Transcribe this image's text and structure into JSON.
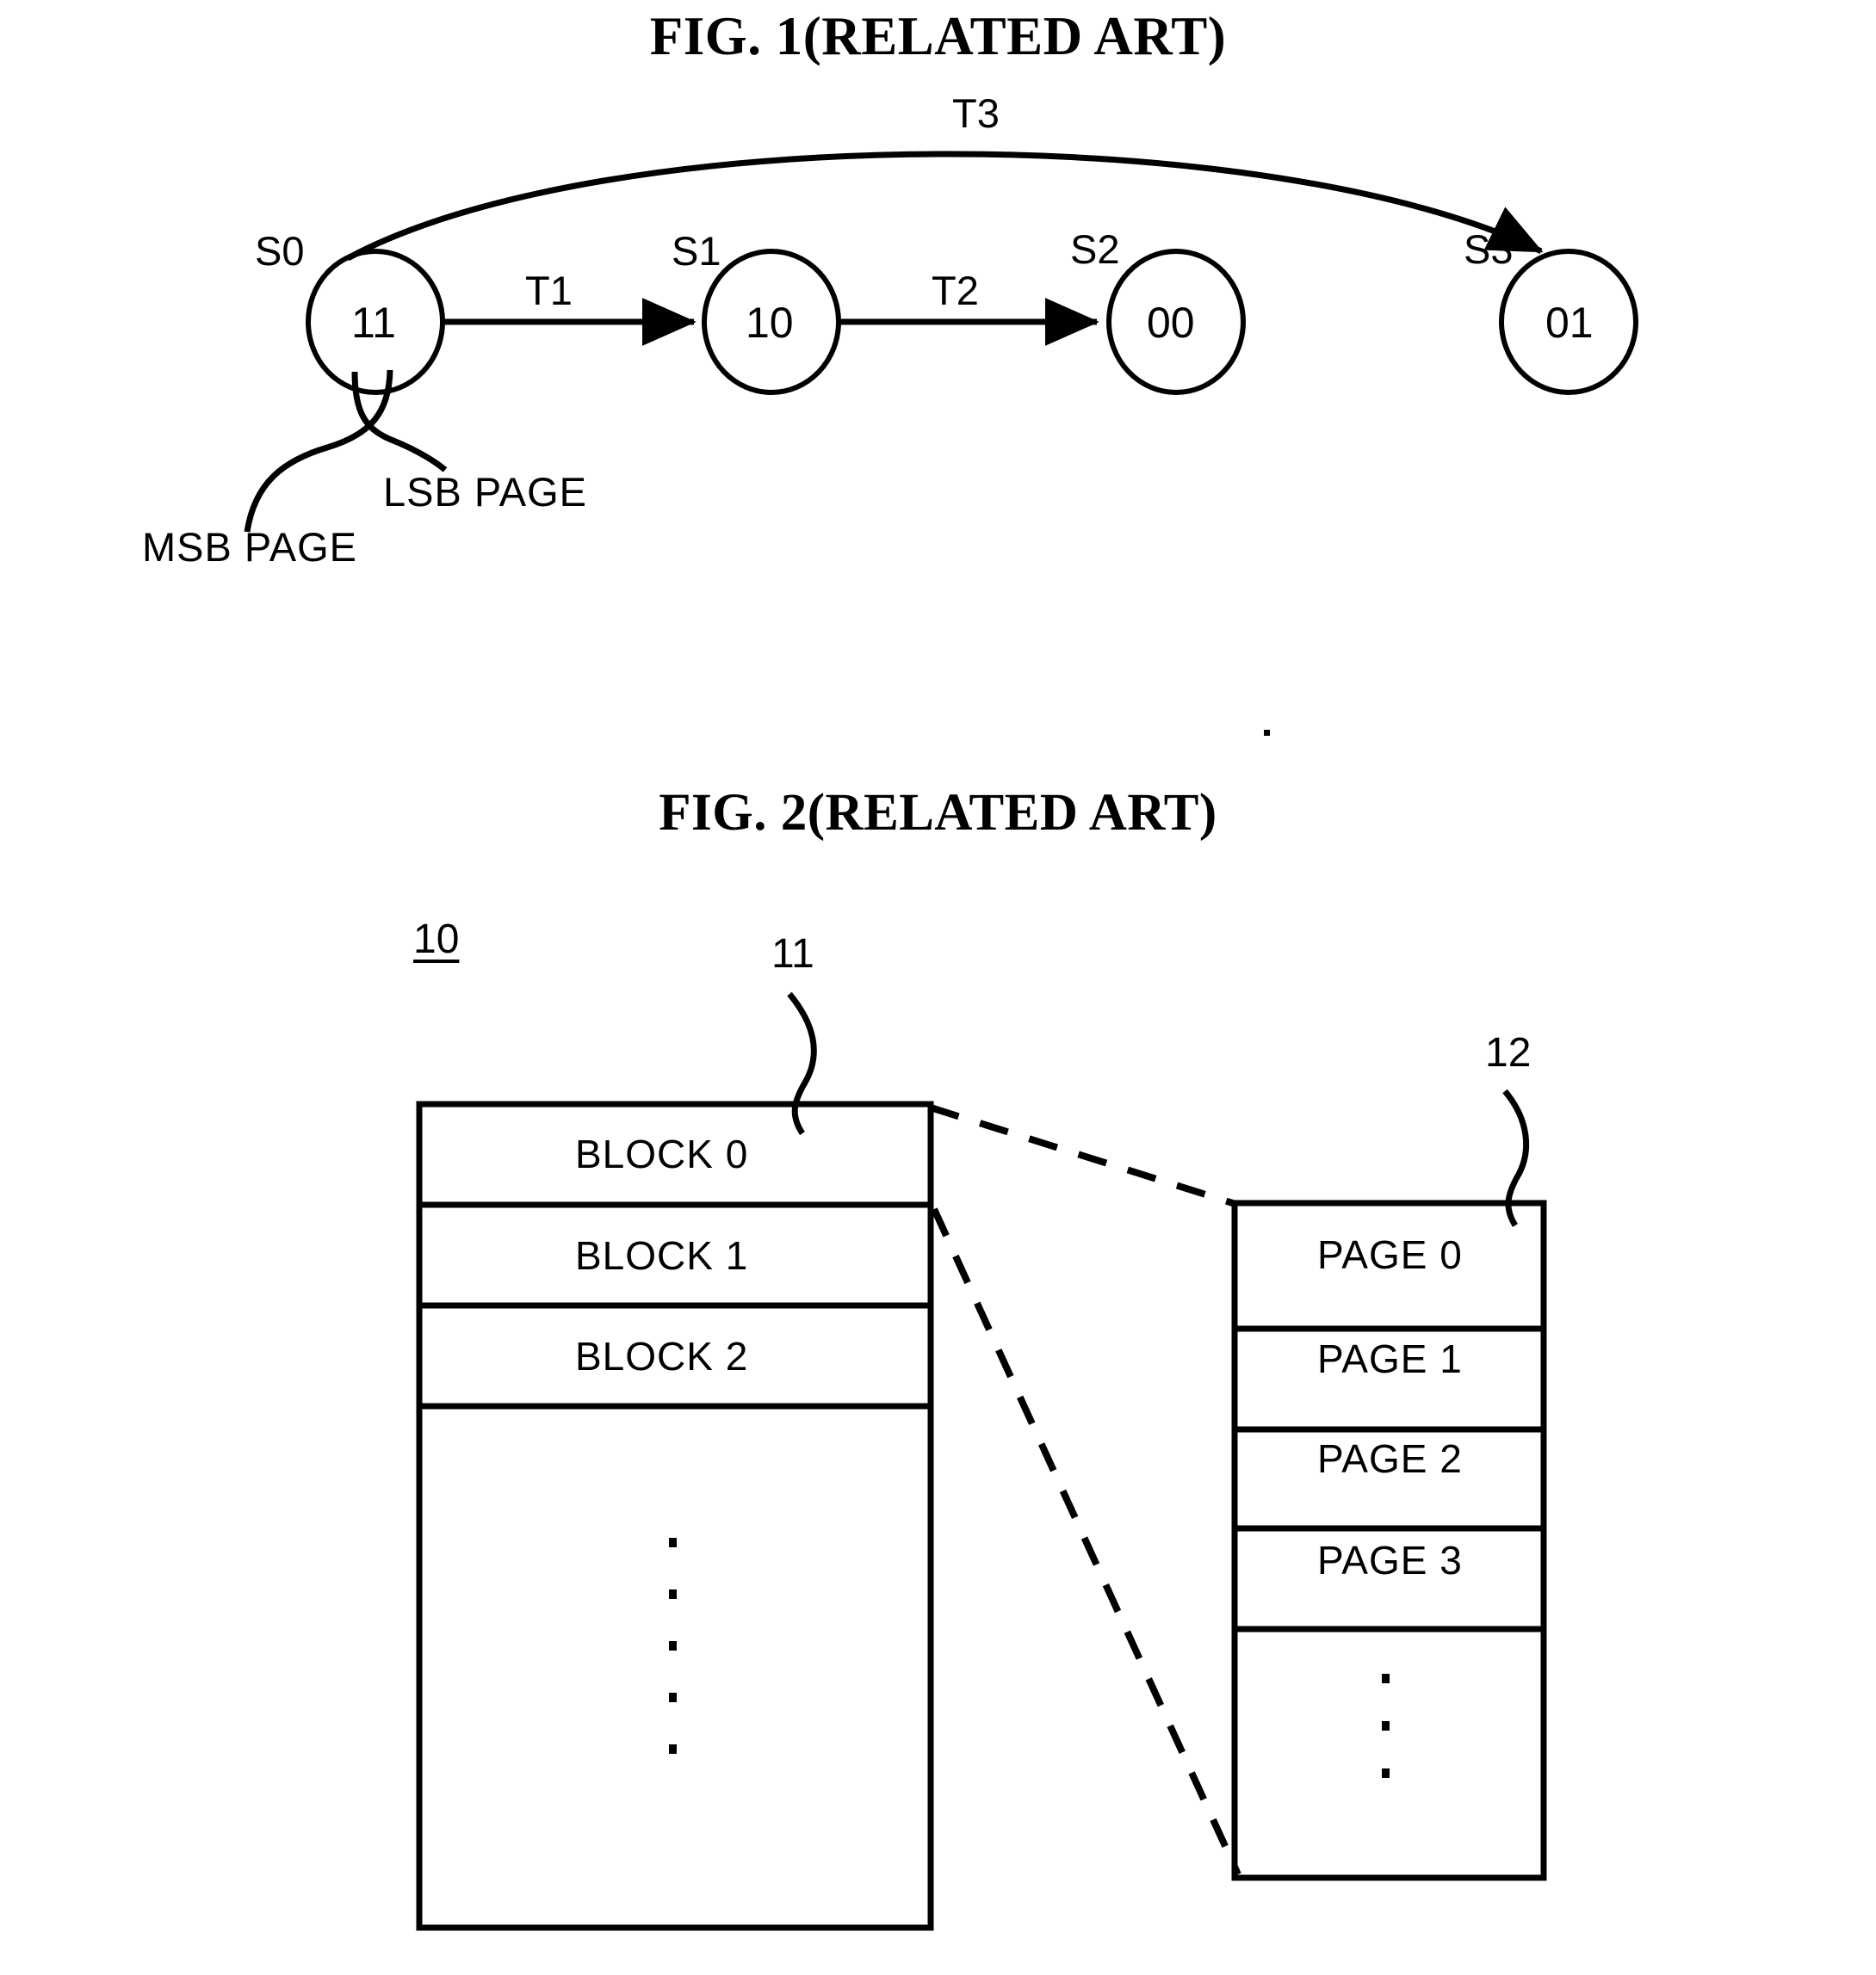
{
  "figures": [
    {
      "id": "fig1",
      "title": "FIG. 1(RELATED ART)",
      "type": "state-transition-diagram",
      "states": [
        {
          "name": "S0",
          "value": "11"
        },
        {
          "name": "S1",
          "value": "10"
        },
        {
          "name": "S2",
          "value": "00"
        },
        {
          "name": "S3",
          "value": "01"
        }
      ],
      "transitions": [
        {
          "label": "T1",
          "from": "S0",
          "to": "S1"
        },
        {
          "label": "T2",
          "from": "S1",
          "to": "S2"
        },
        {
          "label": "T3",
          "from": "S0",
          "to": "S3"
        }
      ],
      "callouts": [
        {
          "label": "MSB PAGE",
          "points_to": "S0 value bit 1"
        },
        {
          "label": "LSB PAGE",
          "points_to": "S0 value bit 2"
        }
      ]
    },
    {
      "id": "fig2",
      "title": "FIG. 2(RELATED ART)",
      "type": "memory-layout-diagram",
      "reference_numerals": [
        {
          "text": "10",
          "style": "underlined",
          "target": "memory-device"
        },
        {
          "text": "11",
          "style": "leader",
          "target": "block-0"
        },
        {
          "text": "12",
          "style": "leader",
          "target": "page-0"
        }
      ],
      "block_table": {
        "rows": [
          "BLOCK 0",
          "BLOCK 1",
          "BLOCK 2"
        ],
        "ellipsis": "vertical-dots"
      },
      "page_table": {
        "rows": [
          "PAGE 0",
          "PAGE 1",
          "PAGE 2",
          "PAGE 3"
        ],
        "ellipsis": "vertical-dots"
      }
    }
  ],
  "fig1": {
    "title": "FIG. 1(RELATED ART)",
    "states": {
      "s0": {
        "name": "S0",
        "value": "11"
      },
      "s1": {
        "name": "S1",
        "value": "10"
      },
      "s2": {
        "name": "S2",
        "value": "00"
      },
      "s3": {
        "name": "S3",
        "value": "01"
      }
    },
    "transitions": {
      "t1": "T1",
      "t2": "T2",
      "t3": "T3"
    },
    "callouts": {
      "msb": "MSB PAGE",
      "lsb": "LSB PAGE"
    }
  },
  "fig2": {
    "title": "FIG. 2(RELATED ART)",
    "refs": {
      "device": "10",
      "block": "11",
      "page": "12"
    },
    "blocks": {
      "b0": "BLOCK 0",
      "b1": "BLOCK 1",
      "b2": "BLOCK 2"
    },
    "pages": {
      "p0": "PAGE 0",
      "p1": "PAGE 1",
      "p2": "PAGE 2",
      "p3": "PAGE 3"
    }
  },
  "colors": {
    "ink": "#000000",
    "paper": "#ffffff"
  }
}
